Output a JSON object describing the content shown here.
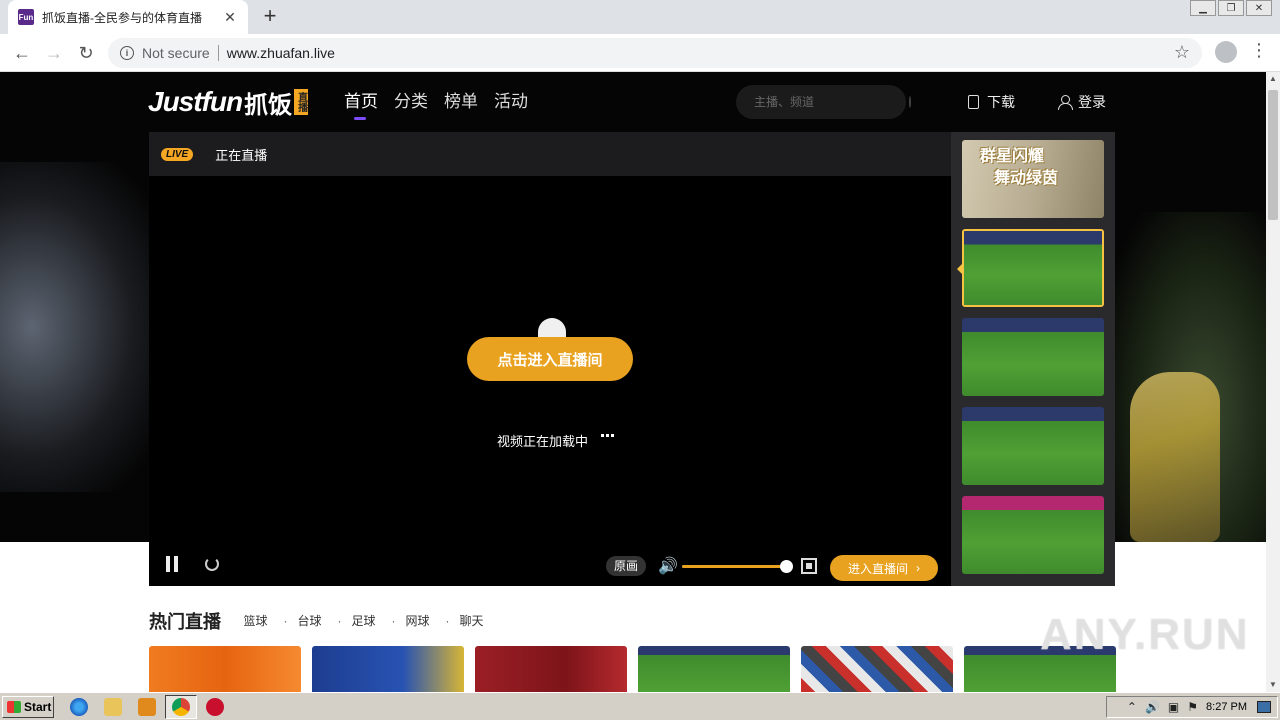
{
  "browser": {
    "tab_title": "抓饭直播-全民参与的体育直播",
    "favicon_text": "Fun",
    "tab_close": "✕",
    "new_tab": "+",
    "security_label": "Not secure",
    "url": "www.zhuafan.live",
    "window_controls": [
      "▁",
      "❐",
      "✕"
    ]
  },
  "header": {
    "logo_en": "Justfun",
    "logo_cn": "抓饭",
    "logo_badge": "直播",
    "nav": [
      "首页",
      "分类",
      "榜单",
      "活动"
    ],
    "search_placeholder": "主播、频道",
    "download_label": "下载",
    "login_label": "登录"
  },
  "player": {
    "live_badge": "LIVE",
    "live_label": "正在直播",
    "enter_room_button": "点击进入直播间",
    "loading_text": "视频正在加载中",
    "quality_label": "原画",
    "volume_percent": 100,
    "enter_room_small": "进入直播间",
    "chevron": "›"
  },
  "thumbs": {
    "ad_text": [
      "群星闪耀",
      "舞动绿茵"
    ],
    "items": [
      {
        "type": "ad",
        "active": false
      },
      {
        "type": "match",
        "active": true
      },
      {
        "type": "match",
        "active": false
      },
      {
        "type": "match",
        "active": false
      },
      {
        "type": "match-pink",
        "active": false
      }
    ]
  },
  "hot": {
    "title": "热门直播",
    "categories": [
      "篮球",
      "台球",
      "足球",
      "网球",
      "聊天"
    ]
  },
  "watermark": "ANY.RUN",
  "taskbar": {
    "start_label": "Start",
    "time": "8:27 PM",
    "tray_icons": [
      "⌃",
      "🔊",
      "▣",
      "⚑"
    ]
  },
  "colors": {
    "accent": "#e9a21f",
    "nav_active_underline": "#7b4dff",
    "thumb_active_border": "#f5c242"
  }
}
